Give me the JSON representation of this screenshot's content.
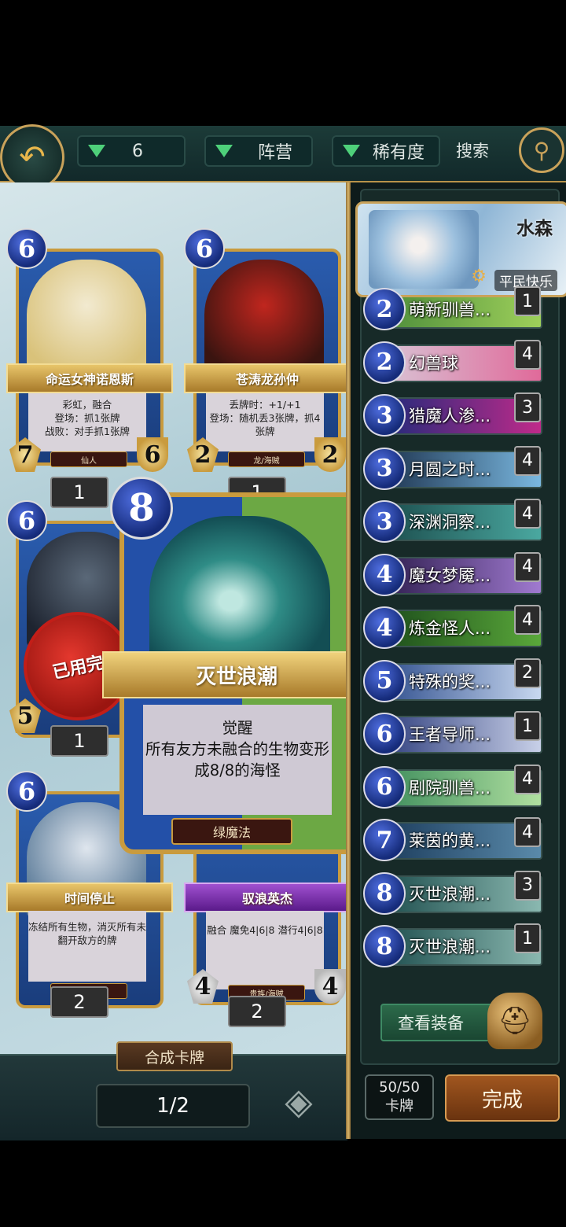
{
  "topbar": {
    "filters": [
      {
        "label": "6"
      },
      {
        "label": "阵营"
      },
      {
        "label": "稀有度"
      }
    ],
    "search_label": "搜索",
    "accent": "#4ed07a"
  },
  "cards": [
    {
      "cost": "6",
      "name": "命运女神诺恩斯",
      "text": "彩虹，融合\n登场：抓1张牌\n战败：对手抓1张牌",
      "tribe": "仙人",
      "attack": "7",
      "health": "6",
      "qty": "1",
      "art_colors": [
        "#f2ead0",
        "#d9c27a"
      ]
    },
    {
      "cost": "6",
      "name": "苍涛龙孙仲",
      "text": "丢牌时：+1/+1\n登场：随机丢3张牌，抓4张牌",
      "tribe": "龙/海贼",
      "attack": "2",
      "health": "2",
      "qty": "1",
      "art_colors": [
        "#c0261e",
        "#3a1410"
      ]
    },
    {
      "cost": "6",
      "attack": "5",
      "qty": "1",
      "used_label": "已用完",
      "art_colors": [
        "#5a6878",
        "#1e2430"
      ]
    },
    {
      "cost": "6",
      "name": "时间停止",
      "text": "冻结所有生物，消灭所有未翻开敌方的牌",
      "tribe": "科学",
      "qty": "2",
      "art_colors": [
        "#dfe6ee",
        "#5a7a98"
      ]
    },
    {
      "name": "驭浪英杰",
      "text": "融合\n魔免4|6|8\n潜行4|6|8",
      "tribe": "贵族/海贼",
      "attack": "4",
      "health": "4",
      "qty": "2"
    }
  ],
  "featured_card": {
    "cost": "8",
    "name": "灭世浪潮",
    "text": "觉醒\n所有友方未融合的生物变形成8/8的海怪",
    "tribe": "绿魔法"
  },
  "synthesis": {
    "label": "合成卡牌"
  },
  "pager": {
    "label": "1/2"
  },
  "hero": {
    "name": "水森",
    "tag": "平民快乐"
  },
  "deck": [
    {
      "cost": "2",
      "name": "萌新驯兽...",
      "count": "1",
      "colors": [
        "#4a8a3a",
        "#9ed05a"
      ]
    },
    {
      "cost": "2",
      "name": "幻兽球",
      "count": "4",
      "colors": [
        "#d8c8d8",
        "#e06a9a"
      ]
    },
    {
      "cost": "3",
      "name": "猎魔人渗...",
      "count": "3",
      "colors": [
        "#1a2a7a",
        "#c02a8a"
      ]
    },
    {
      "cost": "3",
      "name": "月圆之时...",
      "count": "4",
      "colors": [
        "#1a2f4a",
        "#7ab8e0"
      ]
    },
    {
      "cost": "3",
      "name": "深渊洞察...",
      "count": "4",
      "colors": [
        "#1a4a4a",
        "#4aa8a0"
      ]
    },
    {
      "cost": "4",
      "name": "魔女梦魇...",
      "count": "4",
      "colors": [
        "#2a1a4a",
        "#a07ad0"
      ]
    },
    {
      "cost": "4",
      "name": "炼金怪人...",
      "count": "4",
      "colors": [
        "#1a4a1a",
        "#5aa83a"
      ]
    },
    {
      "cost": "5",
      "name": "特殊的奖...",
      "count": "2",
      "colors": [
        "#2a4a8a",
        "#c8d8f0"
      ]
    },
    {
      "cost": "6",
      "name": "王者导师...",
      "count": "1",
      "colors": [
        "#2a3a7a",
        "#c8d0e8"
      ]
    },
    {
      "cost": "6",
      "name": "剧院驯兽...",
      "count": "4",
      "colors": [
        "#3a8a5a",
        "#b0e0a0"
      ]
    },
    {
      "cost": "7",
      "name": "莱茵的黄...",
      "count": "4",
      "colors": [
        "#1a3a5a",
        "#5a8aaa"
      ]
    },
    {
      "cost": "8",
      "name": "灭世浪潮...",
      "count": "3",
      "colors": [
        "#1a4a4a",
        "#8ab8b0"
      ]
    },
    {
      "cost": "8",
      "name": "灭世浪潮...",
      "count": "1",
      "colors": [
        "#1a4a4a",
        "#8ab8b0"
      ]
    }
  ],
  "equip": {
    "label": "查看装备"
  },
  "deck_count": {
    "value": "50/50",
    "unit": "卡牌"
  },
  "done": {
    "label": "完成"
  }
}
